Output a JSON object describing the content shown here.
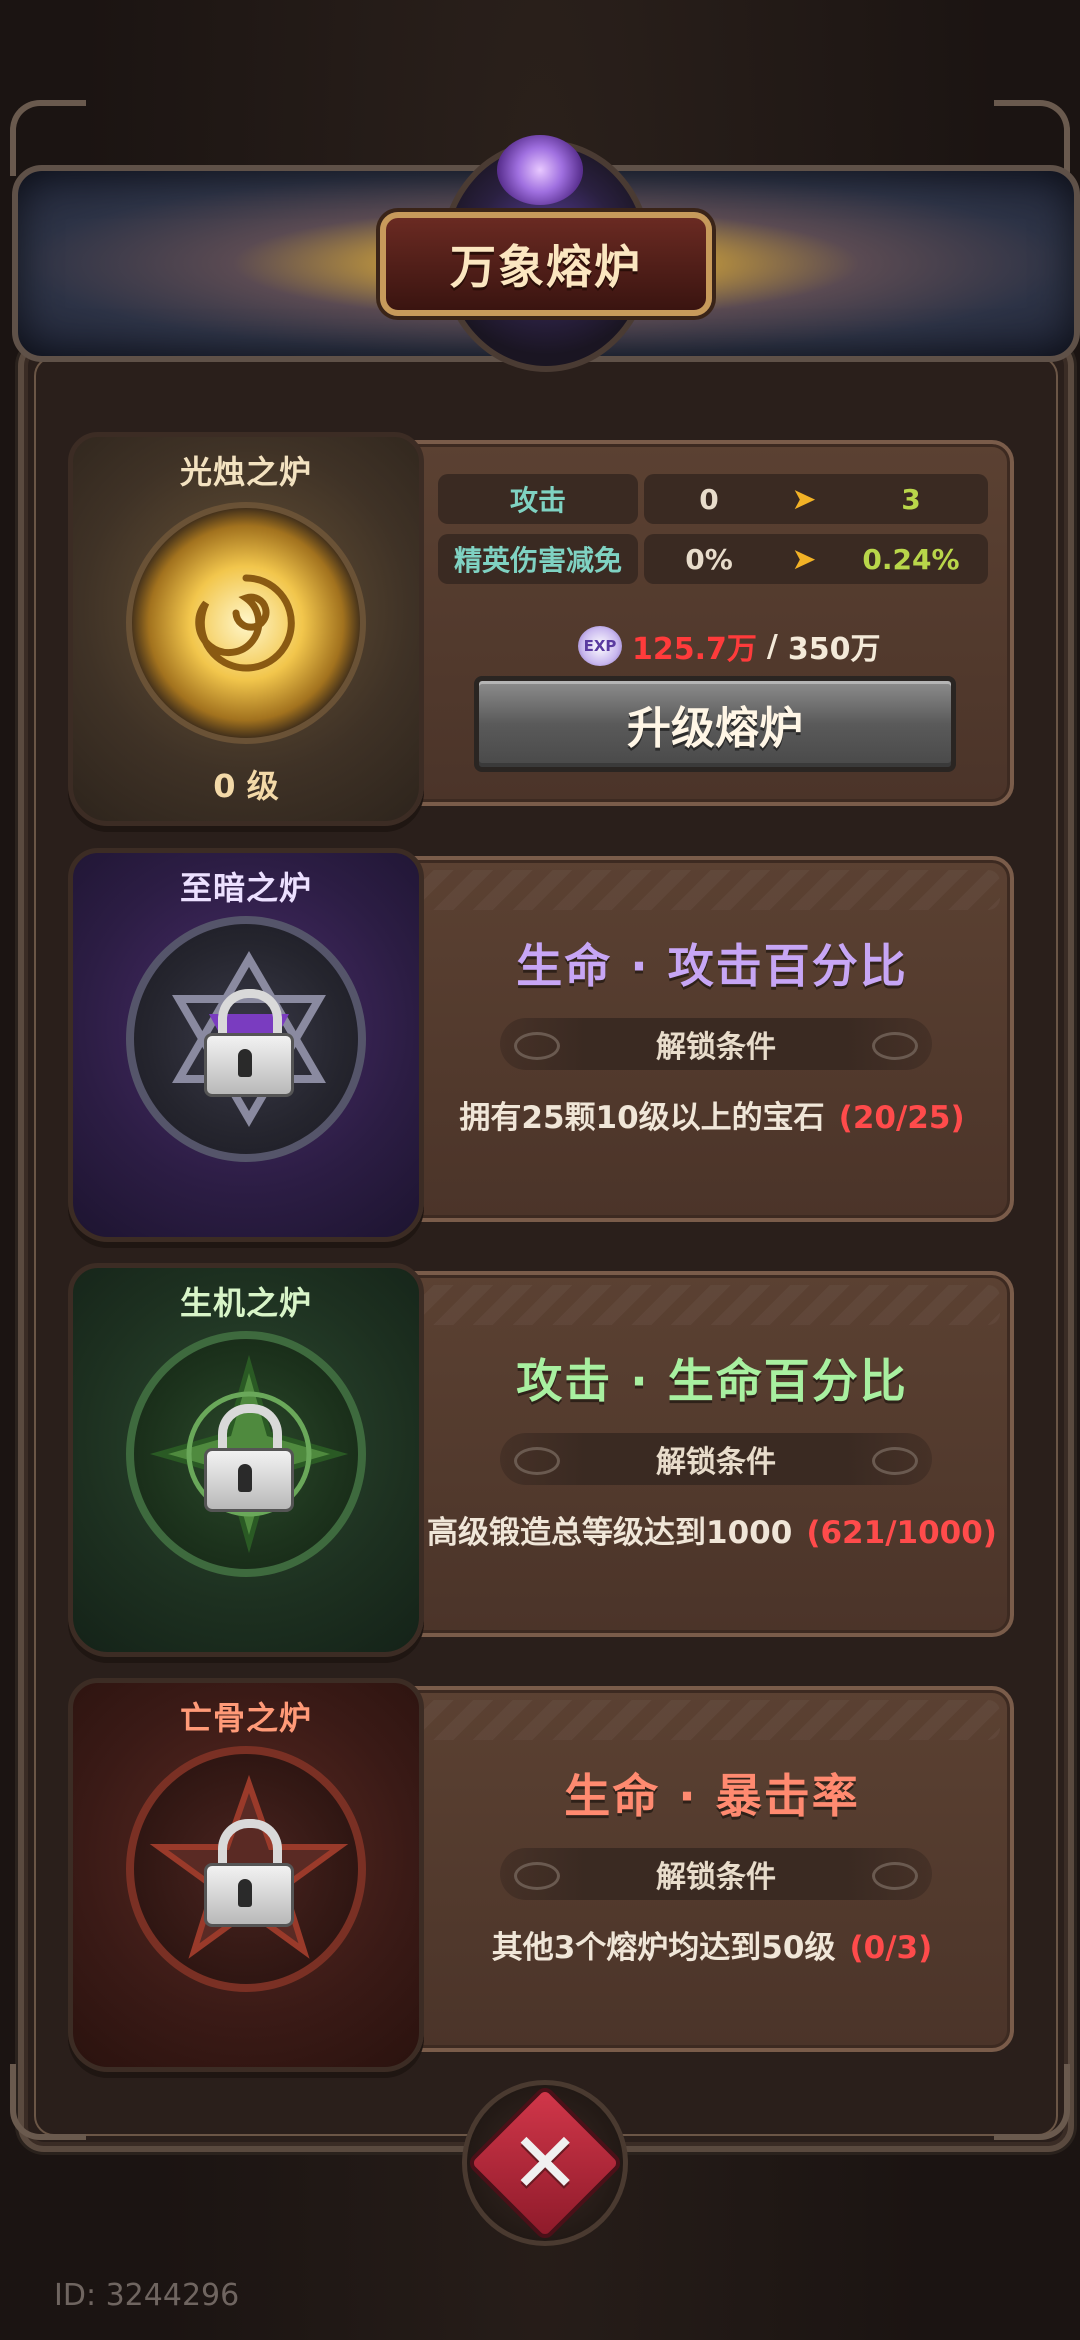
{
  "header": {
    "title": "万象熔炉"
  },
  "furnaces": [
    {
      "name": "光烛之炉",
      "level": "0 级",
      "stats": [
        {
          "label": "攻击",
          "from": "0",
          "to": "3"
        },
        {
          "label": "精英伤害减免",
          "from": "0%",
          "to": "0.24%"
        }
      ],
      "exp": {
        "icon": "EXP",
        "current": "125.7万",
        "separator": "/",
        "max": "350万"
      },
      "upgrade_label": "升级熔炉",
      "color": "#e9c766"
    },
    {
      "name": "至暗之炉",
      "bonus": "生命 · 攻击百分比",
      "condition_label": "解锁条件",
      "condition": "拥有25颗10级以上的宝石",
      "progress": "(20/25)",
      "color": "#c7a6f5"
    },
    {
      "name": "生机之炉",
      "bonus": "攻击 · 生命百分比",
      "condition_label": "解锁条件",
      "condition": "高级锻造总等级达到1000",
      "progress": "(621/1000)",
      "color": "#a8f0a0"
    },
    {
      "name": "亡骨之炉",
      "bonus": "生命 · 暴击率",
      "condition_label": "解锁条件",
      "condition": "其他3个熔炉均达到50级",
      "progress": "(0/3)",
      "color": "#ff8a70"
    }
  ],
  "close_icon": "close-x-icon",
  "footer": {
    "user_id": "ID: 3244296"
  }
}
